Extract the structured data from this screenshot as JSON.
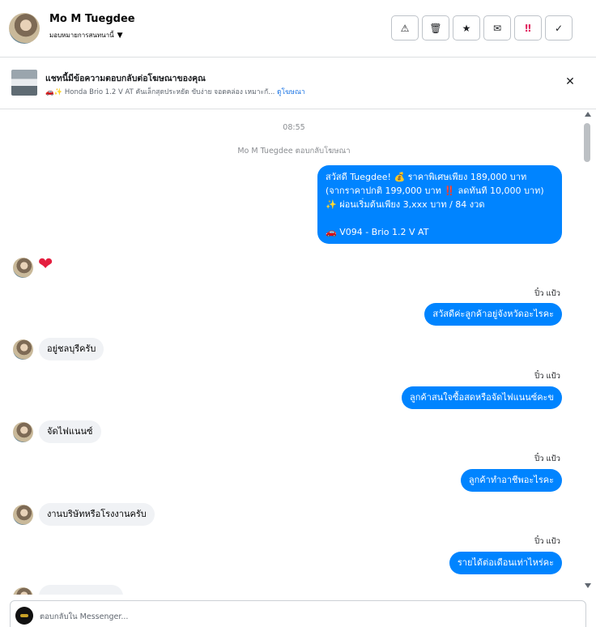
{
  "header": {
    "contact_name": "Mo M Tuegdee",
    "assign_label": "มอบหมายการสนทนานี้",
    "actions": [
      {
        "icon": "warning-icon",
        "glyph": "⚠"
      },
      {
        "icon": "trash-icon",
        "glyph": "🗑"
      },
      {
        "icon": "star-icon",
        "glyph": "★"
      },
      {
        "icon": "mark-unread-icon",
        "glyph": "✉"
      },
      {
        "icon": "follow-up-icon",
        "glyph": "‼"
      },
      {
        "icon": "done-check-icon",
        "glyph": "✓"
      }
    ]
  },
  "ad_banner": {
    "title": "แชทนี้มีข้อความตอบกลับต่อโฆษณาของคุณ",
    "subtitle": "🚗✨ Honda Brio 1.2 V AT คันเล็กสุดประหยัด ขับง่าย จอดคล่อง เหมาะกั...",
    "link": "ดูโฆษณา"
  },
  "thread": {
    "timestamp": "08:55",
    "reply_note": "Mo M Tuegdee ตอบกลับโฆษณา",
    "ad_message_lines": [
      "สวัสดี Tuegdee! 💰 ราคาพิเศษเพียง 189,000 บาท",
      "(จากราคาปกติ 199,000 บาท ‼️ ลดทันที 10,000 บาท)",
      "✨ ผ่อนเริ่มต้นเพียง 3,xxx บาท / 84 งวด",
      "",
      "🚗 V094 - Brio 1.2 V AT"
    ],
    "heart": "❤",
    "messages": [
      {
        "direction": "out",
        "sender": "ปิ๋ว แป้ว",
        "text": "สวัสดีค่ะลูกค้าอยู่จังหวัดอะไรคะ"
      },
      {
        "direction": "in",
        "text": "อยู่ชลบุรีครับ"
      },
      {
        "direction": "out",
        "sender": "ปิ๋ว แป้ว",
        "text": "ลูกค้าสนใจซื้อสดหรือจัดไฟแนนซ์คะข"
      },
      {
        "direction": "in",
        "text": "จัดไฟแนนซ์"
      },
      {
        "direction": "out",
        "sender": "ปิ๋ว แป้ว",
        "text": "ลูกค้าทำอาชีพอะไรคะ"
      },
      {
        "direction": "in",
        "text": "งานบริษัทหรือโรงงานครับ"
      },
      {
        "direction": "out",
        "sender": "ปิ๋ว แป้ว",
        "text": "รายได้ต่อเดือนเท่าไหร่คะ"
      }
    ]
  },
  "composer": {
    "placeholder": "ตอบกลับใน Messenger..."
  }
}
